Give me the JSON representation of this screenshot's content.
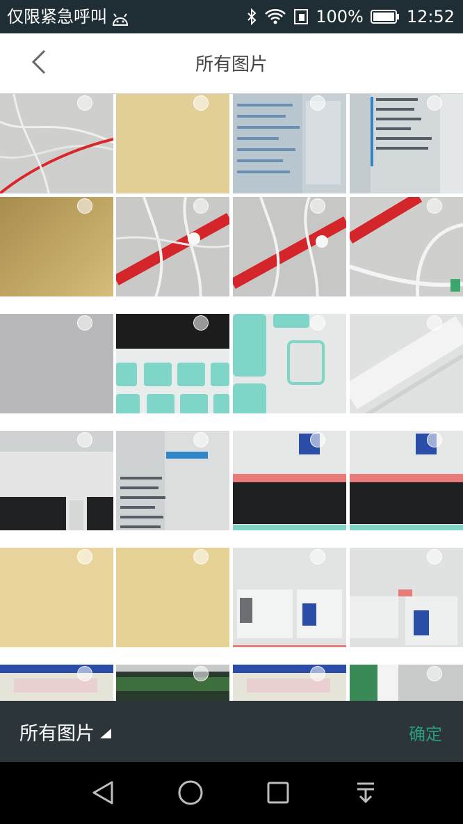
{
  "status_bar": {
    "left_text": "仅限紧急呼叫",
    "battery": "100%",
    "time": "12:52",
    "icons": [
      "android-icon",
      "bluetooth-icon",
      "wifi-icon",
      "sim-icon",
      "battery-icon"
    ]
  },
  "header": {
    "title": "所有图片",
    "back_icon": "chevron-left-icon"
  },
  "grid": {
    "columns": 4,
    "photos": [
      {
        "desc": "white cables with red cable"
      },
      {
        "desc": "beige blank"
      },
      {
        "desc": "screen file list"
      },
      {
        "desc": "screen file list"
      },
      {
        "desc": "gold gradient"
      },
      {
        "desc": "earphones on red cable"
      },
      {
        "desc": "earphones on red cable"
      },
      {
        "desc": "red cable and white cable"
      },
      {
        "desc": "gray blank"
      },
      {
        "desc": "keyboard keys"
      },
      {
        "desc": "keyboard keys close-up"
      },
      {
        "desc": "white surface"
      },
      {
        "desc": "screen window"
      },
      {
        "desc": "screen finder"
      },
      {
        "desc": "phone listing screen"
      },
      {
        "desc": "phone listing screen"
      },
      {
        "desc": "beige blank"
      },
      {
        "desc": "beige blank"
      },
      {
        "desc": "phone listing screen"
      },
      {
        "desc": "phone listing screen"
      },
      {
        "desc": "screen top"
      },
      {
        "desc": "screen top dark"
      },
      {
        "desc": "screen top"
      },
      {
        "desc": "room photo"
      }
    ]
  },
  "bottom_bar": {
    "album_label": "所有图片",
    "confirm_label": "确定",
    "confirm_color": "#2a9c82"
  },
  "nav_bar": {
    "icons": [
      "back-triangle-icon",
      "home-circle-icon",
      "recents-square-icon",
      "notification-pull-icon"
    ]
  }
}
